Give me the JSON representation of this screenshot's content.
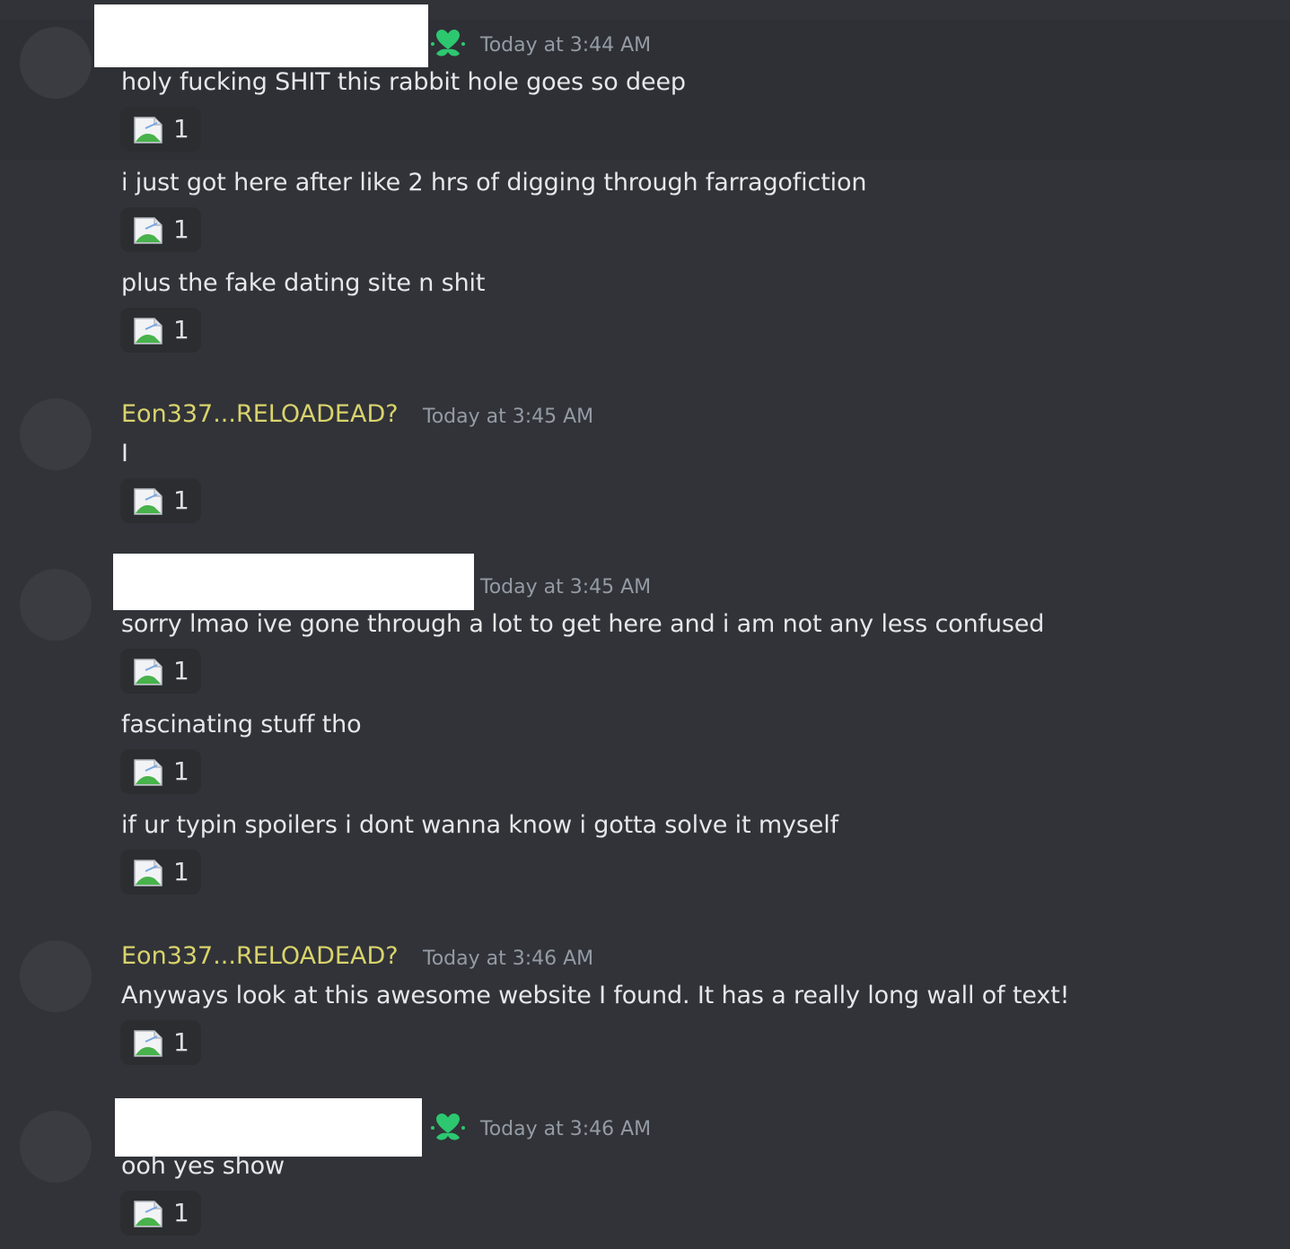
{
  "messages": [
    {
      "author": "",
      "has_badge": true,
      "timestamp": "Today at 3:44 AM",
      "lines": [
        {
          "text": "holy fucking SHIT this rabbit hole goes so deep",
          "reaction_count": "1"
        },
        {
          "text": "i just got here after like 2 hrs of digging through farragofiction",
          "reaction_count": "1"
        },
        {
          "text": "plus the fake dating site n shit",
          "reaction_count": "1"
        }
      ]
    },
    {
      "author": "Eon337...RELOADEAD?",
      "has_badge": false,
      "timestamp": "Today at 3:45 AM",
      "lines": [
        {
          "text": "I",
          "reaction_count": "1"
        }
      ]
    },
    {
      "author": "",
      "has_badge": false,
      "timestamp": "Today at 3:45 AM",
      "lines": [
        {
          "text": "sorry lmao ive gone through a lot to get here and i am not any less confused",
          "reaction_count": "1"
        },
        {
          "text": "fascinating stuff tho",
          "reaction_count": "1"
        },
        {
          "text": "if ur typin spoilers i dont wanna know i gotta solve it myself",
          "reaction_count": "1"
        }
      ]
    },
    {
      "author": "Eon337...RELOADEAD?",
      "has_badge": false,
      "timestamp": "Today at 3:46 AM",
      "lines": [
        {
          "text": "Anyways look at this awesome website I found. It has a really long wall of text!",
          "reaction_count": "1"
        }
      ]
    },
    {
      "author": "",
      "has_badge": true,
      "timestamp": "Today at 3:46 AM",
      "lines": [
        {
          "text": "ooh yes show",
          "reaction_count": "1"
        }
      ]
    }
  ],
  "colors": {
    "background": "#313338",
    "hover_background": "#2e3035",
    "username": "#d9d36c",
    "timestamp": "#949ba4",
    "reaction_bg": "#2b2d31",
    "badge_green": "#2dc770"
  },
  "icons": {
    "badge": "green-heart-flower-icon",
    "reaction": "broken-image-icon"
  }
}
